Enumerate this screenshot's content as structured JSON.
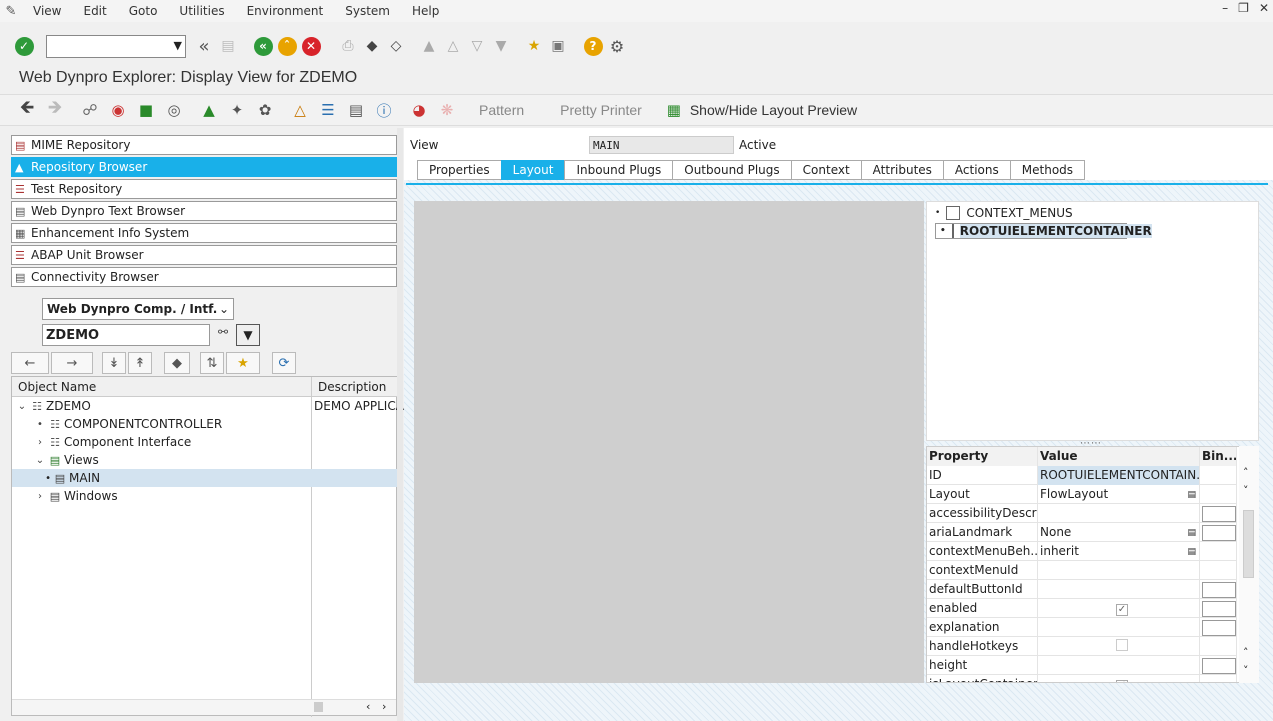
{
  "menu": {
    "items": [
      "View",
      "Edit",
      "Goto",
      "Utilities",
      "Environment",
      "System",
      "Help"
    ]
  },
  "toolbar": {
    "command_field": ""
  },
  "title": "Web Dynpro Explorer: Display View for ZDEMO",
  "toolbar2": {
    "pattern": "Pattern",
    "pretty_printer": "Pretty Printer",
    "layout_preview": "Show/Hide Layout Preview"
  },
  "nav": {
    "items": [
      "MIME Repository",
      "Repository Browser",
      "Test Repository",
      "Web Dynpro Text Browser",
      "Enhancement Info System",
      "ABAP Unit Browser",
      "Connectivity Browser"
    ],
    "active": "Repository Browser"
  },
  "object_type": "Web Dynpro Comp. / Intf.",
  "object_name_value": "ZDEMO",
  "tree": {
    "col_object": "Object Name",
    "col_desc": "Description",
    "root": "ZDEMO",
    "root_desc": "DEMO APPLICA",
    "controller": "COMPONENTCONTROLLER",
    "interface": "Component Interface",
    "views": "Views",
    "main": "MAIN",
    "windows": "Windows"
  },
  "view": {
    "label": "View",
    "name": "MAIN",
    "status": "Active"
  },
  "tabs": [
    "Properties",
    "Layout",
    "Inbound Plugs",
    "Outbound Plugs",
    "Context",
    "Attributes",
    "Actions",
    "Methods"
  ],
  "active_tab": "Layout",
  "outline": [
    "CONTEXT_MENUS",
    "ROOTUIELEMENTCONTAINER"
  ],
  "props": {
    "headers": [
      "Property",
      "Value",
      "Bin..."
    ],
    "rows": [
      {
        "name": "ID",
        "value": "ROOTUIELEMENTCONTAIN..."
      },
      {
        "name": "Layout",
        "value": "FlowLayout"
      },
      {
        "name": "accessibilityDescri...",
        "value": ""
      },
      {
        "name": "ariaLandmark",
        "value": "None"
      },
      {
        "name": "contextMenuBeh...",
        "value": "inherit"
      },
      {
        "name": "contextMenuId",
        "value": ""
      },
      {
        "name": "defaultButtonId",
        "value": ""
      },
      {
        "name": "enabled",
        "value": ""
      },
      {
        "name": "explanation",
        "value": ""
      },
      {
        "name": "handleHotkeys",
        "value": ""
      },
      {
        "name": "height",
        "value": ""
      },
      {
        "name": "isLayoutContainer",
        "value": ""
      }
    ]
  }
}
